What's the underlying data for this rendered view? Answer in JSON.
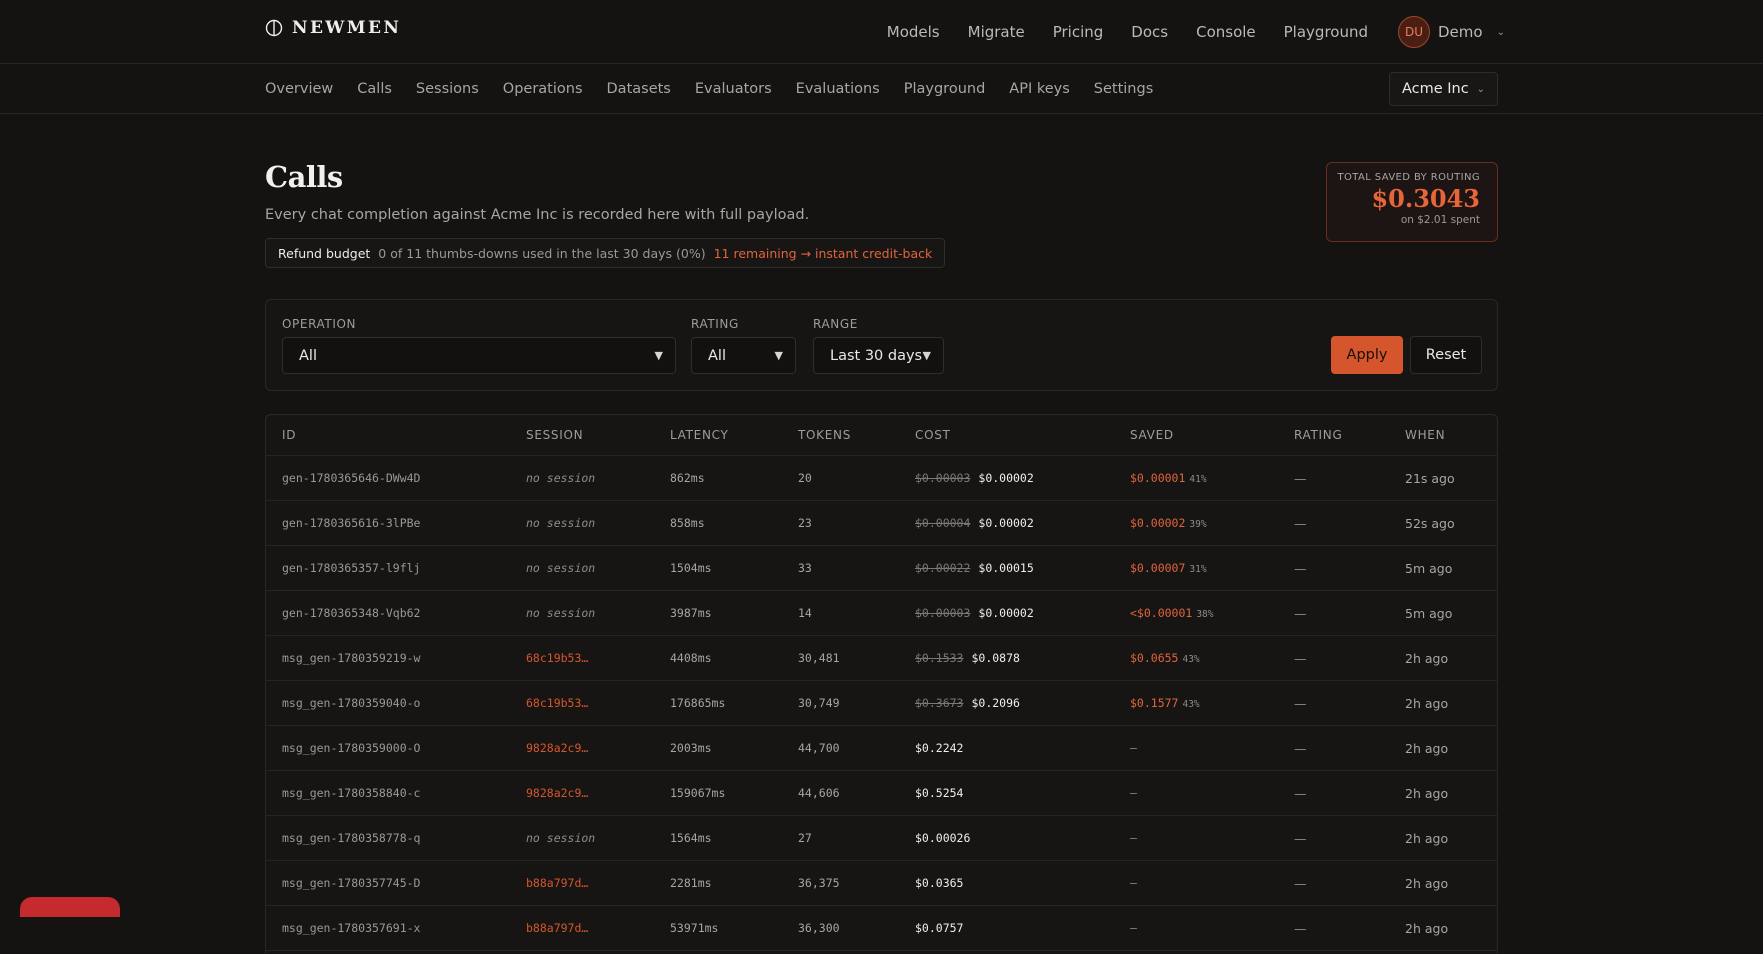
{
  "brand": {
    "name": "NEWMEN"
  },
  "topnav": [
    "Models",
    "Migrate",
    "Pricing",
    "Docs",
    "Console",
    "Playground"
  ],
  "user": {
    "initials": "DU",
    "name": "Demo"
  },
  "subnav": [
    "Overview",
    "Calls",
    "Sessions",
    "Operations",
    "Datasets",
    "Evaluators",
    "Evaluations",
    "Playground",
    "API keys",
    "Settings"
  ],
  "org": {
    "name": "Acme Inc"
  },
  "page": {
    "title": "Calls",
    "subtitle": "Every chat completion against Acme Inc is recorded here with full payload."
  },
  "refund": {
    "label": "Refund budget",
    "text": "0 of 11 thumbs-downs used in the last 30 days (0%)",
    "link": "11 remaining → instant credit-back"
  },
  "saved_card": {
    "label": "TOTAL SAVED BY ROUTING",
    "amount": "$0.3043",
    "sub": "on $2.01 spent"
  },
  "filters": {
    "operation": {
      "label": "OPERATION",
      "value": "All"
    },
    "rating": {
      "label": "RATING",
      "value": "All"
    },
    "range": {
      "label": "RANGE",
      "value": "Last 30 days"
    },
    "apply": "Apply",
    "reset": "Reset"
  },
  "table": {
    "headers": [
      "ID",
      "SESSION",
      "LATENCY",
      "TOKENS",
      "COST",
      "SAVED",
      "RATING",
      "WHEN"
    ],
    "rows": [
      {
        "id": "gen-1780365646-DWw4D",
        "session": "no session",
        "latency": "862ms",
        "tokens": "20",
        "old_cost": "$0.00003",
        "cost": "$0.00002",
        "saved": "$0.00001",
        "pct": "41%",
        "rating": "—",
        "when": "21s ago"
      },
      {
        "id": "gen-1780365616-3lPBe",
        "session": "no session",
        "latency": "858ms",
        "tokens": "23",
        "old_cost": "$0.00004",
        "cost": "$0.00002",
        "saved": "$0.00002",
        "pct": "39%",
        "rating": "—",
        "when": "52s ago"
      },
      {
        "id": "gen-1780365357-l9flj",
        "session": "no session",
        "latency": "1504ms",
        "tokens": "33",
        "old_cost": "$0.00022",
        "cost": "$0.00015",
        "saved": "$0.00007",
        "pct": "31%",
        "rating": "—",
        "when": "5m ago"
      },
      {
        "id": "gen-1780365348-Vqb62",
        "session": "no session",
        "latency": "3987ms",
        "tokens": "14",
        "old_cost": "$0.00003",
        "cost": "$0.00002",
        "saved": "<$0.00001",
        "pct": "38%",
        "rating": "—",
        "when": "5m ago"
      },
      {
        "id": "msg_gen-1780359219-w",
        "session": "68c19b53…",
        "latency": "4408ms",
        "tokens": "30,481",
        "old_cost": "$0.1533",
        "cost": "$0.0878",
        "saved": "$0.0655",
        "pct": "43%",
        "rating": "—",
        "when": "2h ago"
      },
      {
        "id": "msg_gen-1780359040-o",
        "session": "68c19b53…",
        "latency": "176865ms",
        "tokens": "30,749",
        "old_cost": "$0.3673",
        "cost": "$0.2096",
        "saved": "$0.1577",
        "pct": "43%",
        "rating": "—",
        "when": "2h ago"
      },
      {
        "id": "msg_gen-1780359000-O",
        "session": "9828a2c9…",
        "latency": "2003ms",
        "tokens": "44,700",
        "old_cost": "",
        "cost": "$0.2242",
        "saved": "–",
        "pct": "",
        "rating": "—",
        "when": "2h ago"
      },
      {
        "id": "msg_gen-1780358840-c",
        "session": "9828a2c9…",
        "latency": "159067ms",
        "tokens": "44,606",
        "old_cost": "",
        "cost": "$0.5254",
        "saved": "–",
        "pct": "",
        "rating": "—",
        "when": "2h ago"
      },
      {
        "id": "msg_gen-1780358778-q",
        "session": "no session",
        "latency": "1564ms",
        "tokens": "27",
        "old_cost": "",
        "cost": "$0.00026",
        "saved": "–",
        "pct": "",
        "rating": "—",
        "when": "2h ago"
      },
      {
        "id": "msg_gen-1780357745-D",
        "session": "b88a797d…",
        "latency": "2281ms",
        "tokens": "36,375",
        "old_cost": "",
        "cost": "$0.0365",
        "saved": "–",
        "pct": "",
        "rating": "—",
        "when": "2h ago"
      },
      {
        "id": "msg_gen-1780357691-x",
        "session": "b88a797d…",
        "latency": "53971ms",
        "tokens": "36,300",
        "old_cost": "",
        "cost": "$0.0757",
        "saved": "–",
        "pct": "",
        "rating": "—",
        "when": "2h ago"
      }
    ]
  },
  "colors": {
    "accent": "#d5562c",
    "background": "#141312"
  }
}
